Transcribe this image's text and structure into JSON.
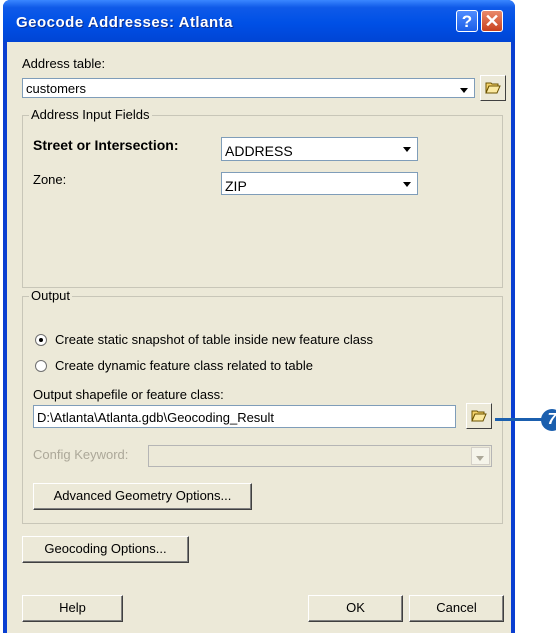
{
  "window": {
    "title": "Geocode Addresses:  Atlanta"
  },
  "address_table": {
    "label": "Address table:",
    "value": "customers"
  },
  "address_input_fields": {
    "title": "Address Input Fields",
    "street_label": "Street or Intersection:",
    "street_value": "ADDRESS",
    "zone_label": "Zone:",
    "zone_value": "ZIP"
  },
  "output": {
    "title": "Output",
    "radio_static": "Create static snapshot of table inside new feature class",
    "radio_dynamic": "Create dynamic feature class related to table",
    "selected": "static",
    "shapefile_label": "Output shapefile or feature class:",
    "shapefile_value": "D:\\Atlanta\\Atlanta.gdb\\Geocoding_Result",
    "config_label": "Config Keyword:",
    "config_value": "",
    "advanced_button": "Advanced Geometry Options..."
  },
  "geocoding_options_button": "Geocoding Options...",
  "footer": {
    "help": "Help",
    "ok": "OK",
    "cancel": "Cancel"
  },
  "callout": {
    "number": "7"
  },
  "icons": [
    "help-icon",
    "close-icon",
    "folder-open-icon",
    "chevron-down-icon"
  ]
}
